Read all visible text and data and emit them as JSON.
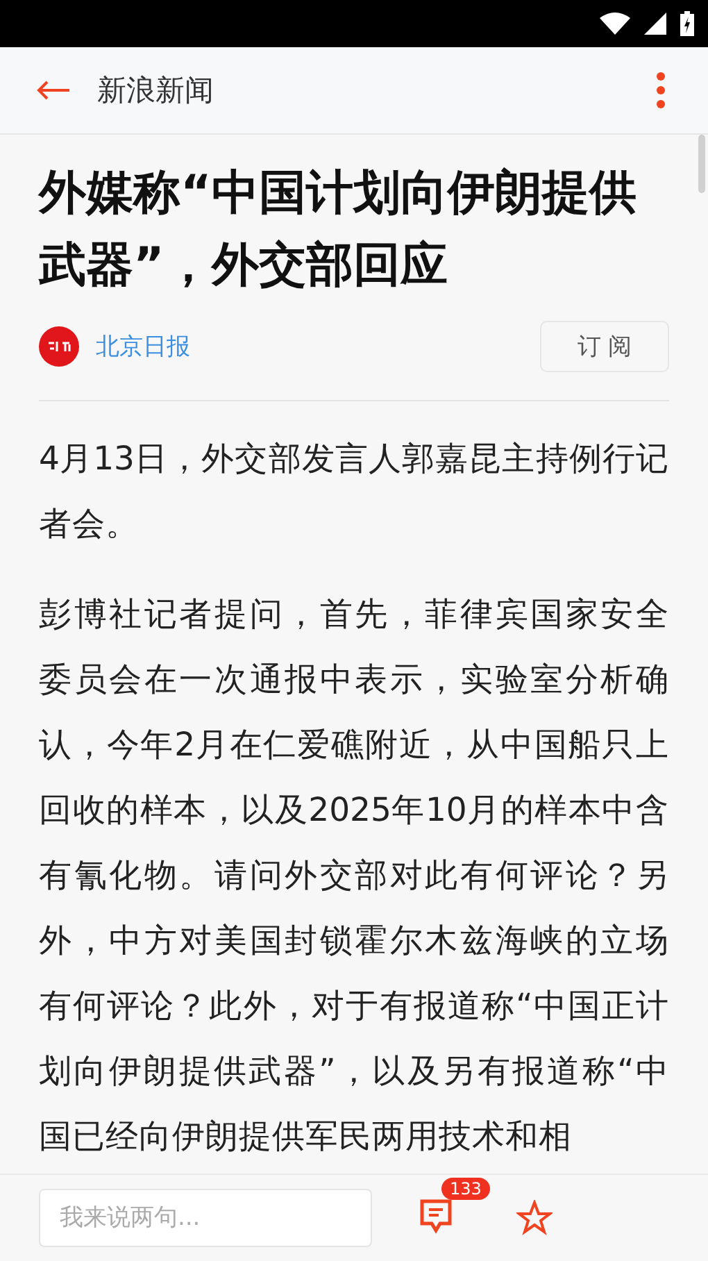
{
  "app_bar": {
    "title": "新浪新闻"
  },
  "article": {
    "headline": "外媒称“中国计划向伊朗提供武器”，外交部回应",
    "source": {
      "name": "北京日报",
      "subscribe_label": "订 阅"
    },
    "paragraphs": [
      "4月13日，外交部发言人郭嘉昆主持例行记者会。",
      "彭博社记者提问，首先，菲律宾国家安全委员会在一次通报中表示，实验室分析确认，今年2月在仁爱礁附近，从中国船只上回收的样本，以及2025年10月的样本中含有氰化物。请问外交部对此有何评论？另外，中方对美国封锁霍尔木兹海峡的立场有何评论？此外，对于有报道称“中国正计划向伊朗提供武器”，以及另有报道称“中国已经向伊朗提供军民两用技术和相"
    ]
  },
  "bottom_bar": {
    "comment_placeholder": "我来说两句...",
    "comment_count": "133"
  }
}
